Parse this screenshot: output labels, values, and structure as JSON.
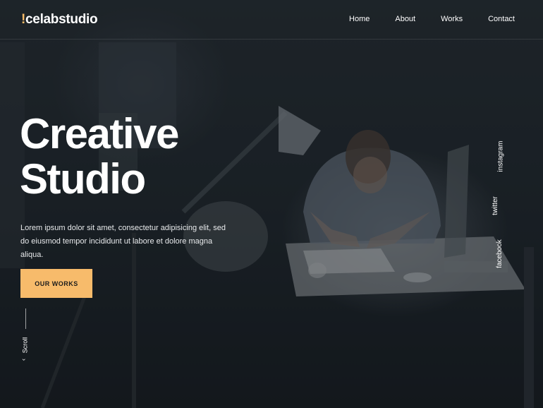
{
  "brand": {
    "mark": "!",
    "name": "celabstudio",
    "accent_color": "#f7bb67"
  },
  "nav": {
    "items": [
      "Home",
      "About",
      "Works",
      "Contact"
    ]
  },
  "hero": {
    "title_line1": "Creative",
    "title_line2": "Studio",
    "description": "Lorem ipsum dolor sit amet, consectetur adipisicing elit, sed do eiusmod tempor incididunt ut labore et dolore magna aliqua.",
    "cta_label": "OUR WORKS",
    "cta_color": "#f7bb6b"
  },
  "scroll": {
    "label": "Scroll",
    "arrow": "‹"
  },
  "social": {
    "items": [
      "instagram",
      "twitter",
      "facebook"
    ]
  }
}
